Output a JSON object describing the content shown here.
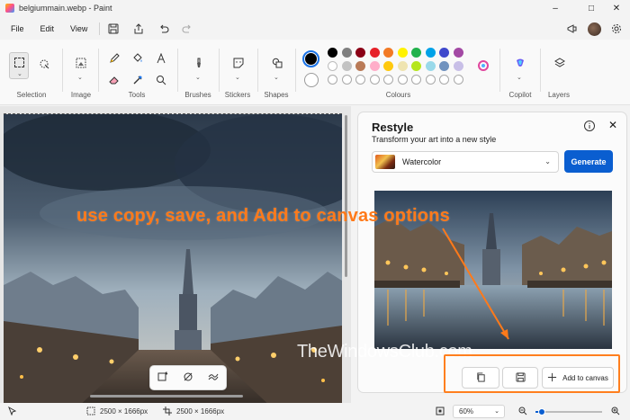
{
  "window": {
    "title": "belgiummain.webp - Paint"
  },
  "menu": {
    "file": "File",
    "edit": "Edit",
    "view": "View"
  },
  "ribbon": {
    "selection": "Selection",
    "image": "Image",
    "tools": "Tools",
    "brushes": "Brushes",
    "stickers": "Stickers",
    "shapes": "Shapes",
    "colours": "Colours",
    "copilot": "Copilot",
    "layers": "Layers"
  },
  "colors": {
    "primary": "#000000",
    "secondary": "#ffffff",
    "palette_row1": [
      "#000000",
      "#7f7f7f",
      "#8b0016",
      "#e62129",
      "#f27a25",
      "#fff200",
      "#22b24c",
      "#00a2e8",
      "#3f48cc",
      "#a349a4"
    ],
    "palette_row2": [
      "#ffffff",
      "#c3c3c3",
      "#b97a57",
      "#ffaec9",
      "#ffc90e",
      "#efe4b0",
      "#b5e61d",
      "#99d9ea",
      "#7092be",
      "#c8bfe7"
    ],
    "accent": "#0a5ed0",
    "annotation": "#ff7a1a"
  },
  "restyle_panel": {
    "title": "Restyle",
    "subtitle": "Transform your art into a new style",
    "style_value": "Watercolor",
    "generate_label": "Generate",
    "add_to_canvas_label": "Add to canvas"
  },
  "annotation": {
    "text": "use copy, save, and Add to canvas options",
    "watermark": "TheWindowsClub.com"
  },
  "status": {
    "canvas_size": "2500 × 1666px",
    "image_size": "2500 × 1666px",
    "zoom_value": "60%",
    "zoom_level": 0.1
  }
}
